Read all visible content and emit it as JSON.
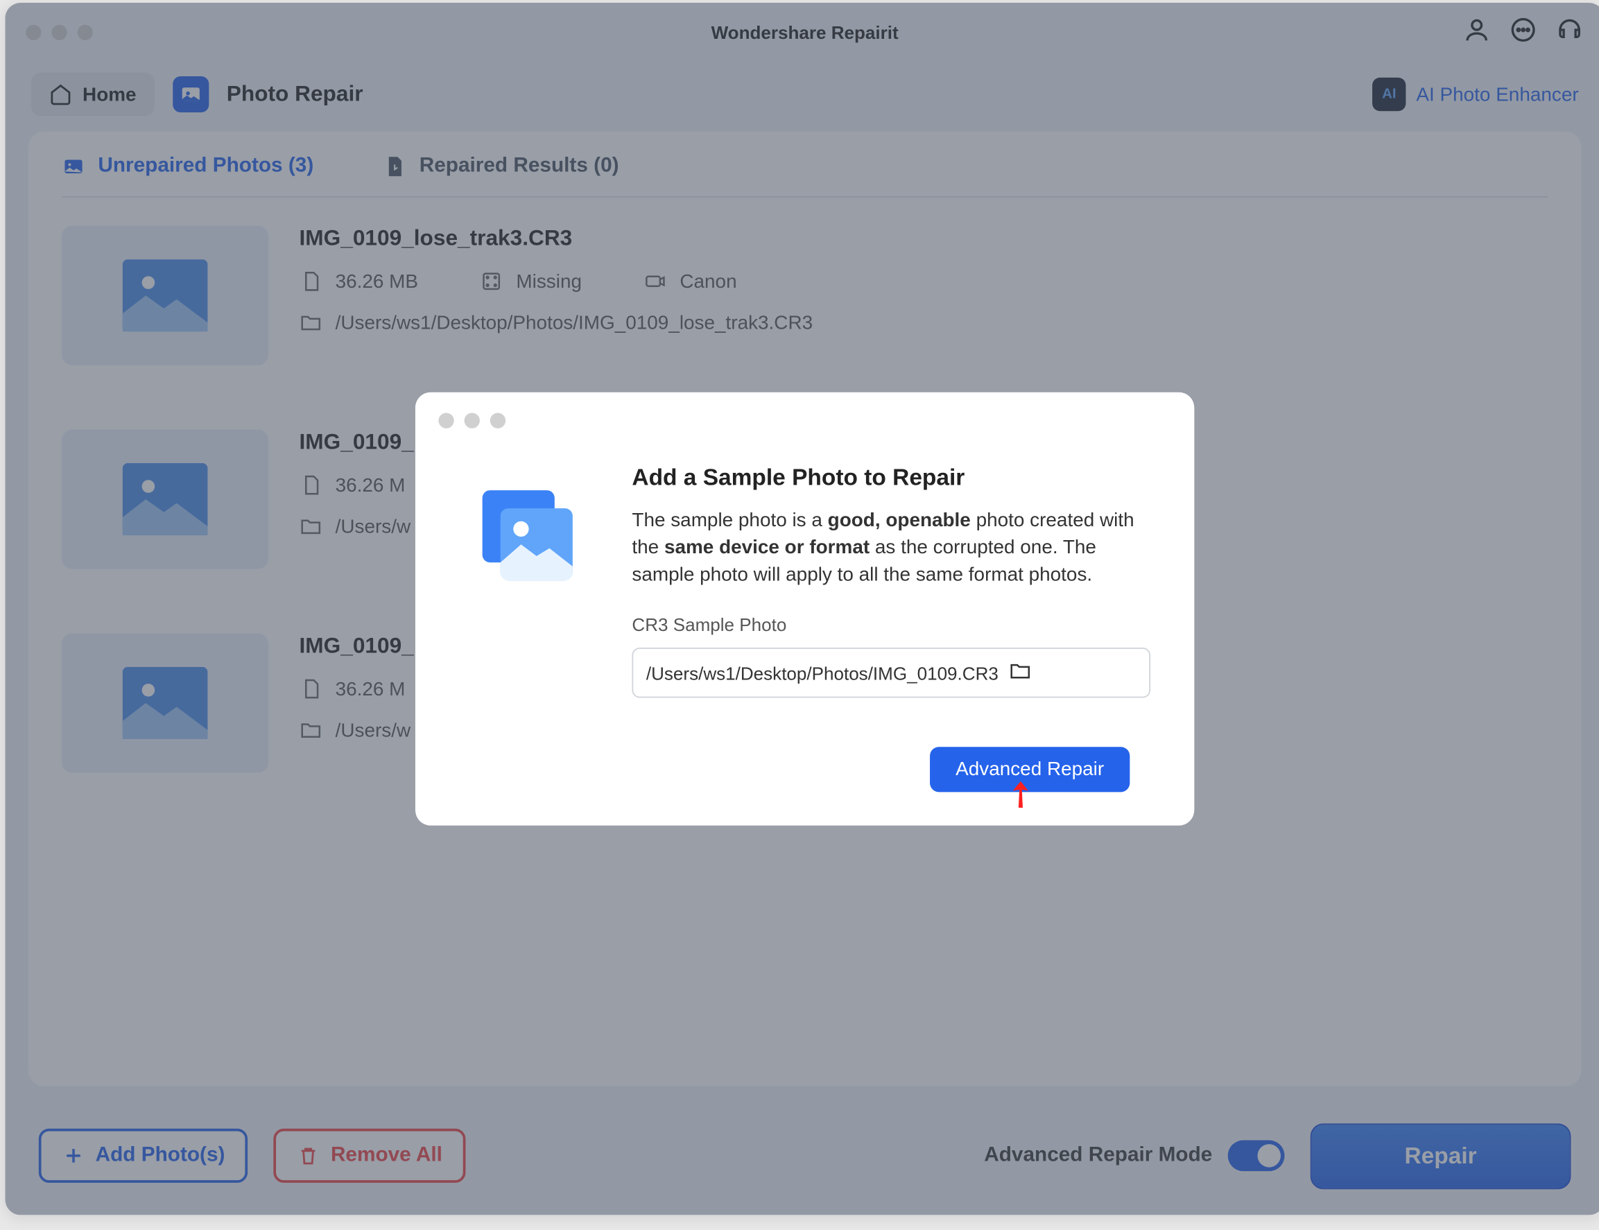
{
  "app": {
    "title": "Wondershare Repairit"
  },
  "toolbar": {
    "home_label": "Home",
    "section_title": "Photo Repair",
    "ai_enhancer_label": "AI Photo Enhancer"
  },
  "tabs": {
    "unrepaired": {
      "label": "Unrepaired Photos (3)"
    },
    "repaired": {
      "label": "Repaired Results (0)"
    }
  },
  "photos": [
    {
      "name": "IMG_0109_lose_trak3.CR3",
      "size": "36.26 MB",
      "status": "Missing",
      "camera": "Canon",
      "path": "/Users/ws1/Desktop/Photos/IMG_0109_lose_trak3.CR3"
    },
    {
      "name": "IMG_0109_",
      "size": "36.26 M",
      "status": "",
      "camera": "",
      "path": "/Users/w"
    },
    {
      "name": "IMG_0109_",
      "size": "36.26 M",
      "status": "",
      "camera": "",
      "path": "/Users/w"
    }
  ],
  "footer": {
    "add_label": "Add Photo(s)",
    "remove_label": "Remove All",
    "adv_mode_label": "Advanced Repair Mode",
    "repair_label": "Repair"
  },
  "dialog": {
    "title": "Add a Sample Photo to Repair",
    "desc_pre": "The sample photo is a ",
    "desc_bold1": "good, openable",
    "desc_mid1": " photo created with the ",
    "desc_bold2": "same device or format",
    "desc_post": " as the corrupted one. The sample photo will apply to all the same format photos.",
    "sample_label": "CR3 Sample Photo",
    "sample_path": "/Users/ws1/Desktop/Photos/IMG_0109.CR3",
    "adv_repair_label": "Advanced Repair"
  }
}
